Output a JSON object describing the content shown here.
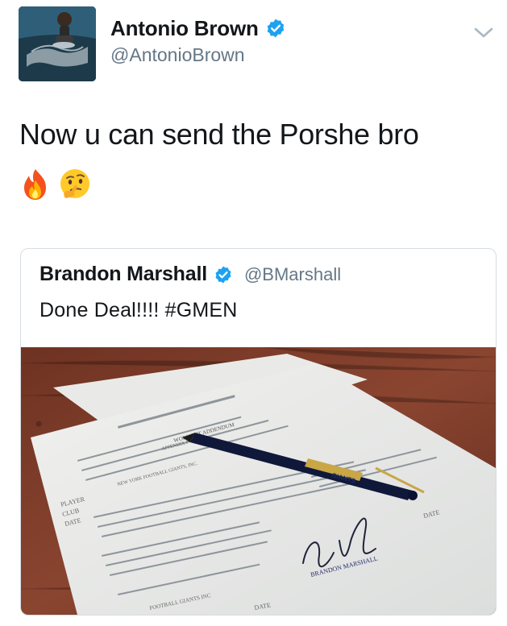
{
  "author": {
    "display_name": "Antonio Brown",
    "handle": "@AntonioBrown",
    "verified": true
  },
  "tweet": {
    "text": "Now u can send the Porshe bro",
    "emojis": [
      "fire-emoji",
      "thinking-face-emoji"
    ]
  },
  "quoted_tweet": {
    "display_name": "Brandon Marshall",
    "handle": "@BMarshall",
    "verified": true,
    "text": "Done Deal!!!! #GMEN",
    "media": {
      "description_icon": "photo-contract-with-pen",
      "document_heading": "WORKOUT ADDENDUM",
      "document_subheading": "APPENDIX P-1",
      "pen_brand": "GIANTS",
      "signature_label": "BRANDON MARSHALL",
      "form_labels": [
        "PLAYER",
        "CLUB",
        "DATE",
        "DATE",
        "DATE"
      ],
      "team_line": "NEW YORK FOOTBALL GIANTS, INC.",
      "footer_line": "FOOTBALL GIANTS INC"
    }
  },
  "colors": {
    "verified_blue": "#1da1f2",
    "handle_gray": "#657786",
    "text": "#14171a",
    "border": "#d6dde2",
    "table_wood": "#7a3a28"
  }
}
